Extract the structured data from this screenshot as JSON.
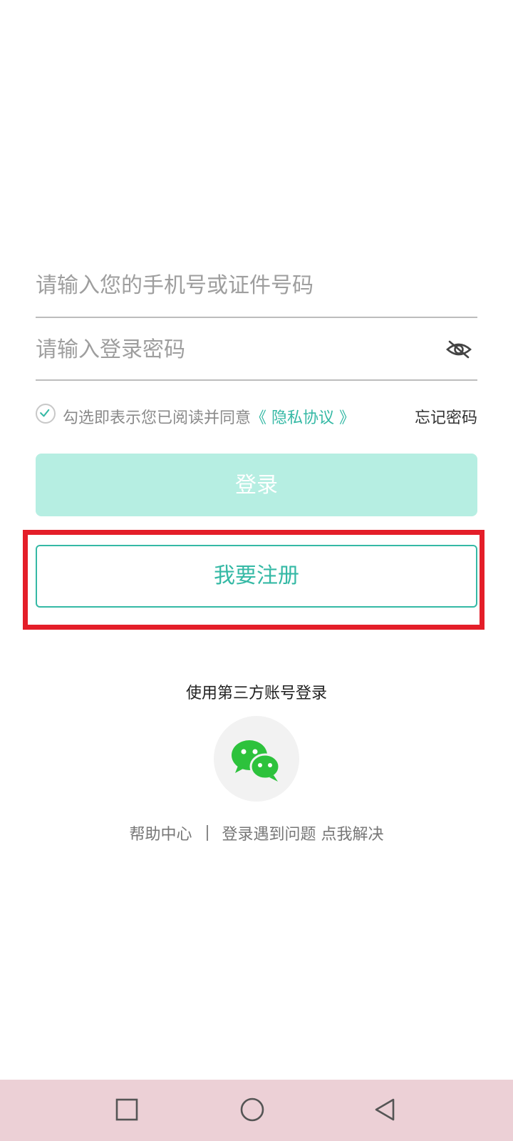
{
  "login_form": {
    "phone_placeholder": "请输入您的手机号或证件号码",
    "password_placeholder": "请输入登录密码",
    "password_visibility_icon": "eye-slash-icon",
    "agreement_prefix": "勾选即表示您已阅读并同意",
    "privacy_link": "《 隐私协议 》",
    "forgot_password": "忘记密码",
    "login_button": "登录",
    "register_button": "我要注册"
  },
  "third_party": {
    "title": "使用第三方账号登录",
    "provider_icon": "wechat-icon"
  },
  "help": {
    "help_center": "帮助中心",
    "problem_link": "登录遇到问题 点我解决"
  },
  "nav_bar": {
    "buttons": [
      "recent-apps-icon",
      "home-icon",
      "back-icon"
    ]
  },
  "colors": {
    "accent": "#35b9a5",
    "login_disabled_bg": "#b6eee2",
    "highlight_box": "#e41e29",
    "nav_bar_bg": "#ecd0d6",
    "wechat_green": "#2dc23c"
  }
}
